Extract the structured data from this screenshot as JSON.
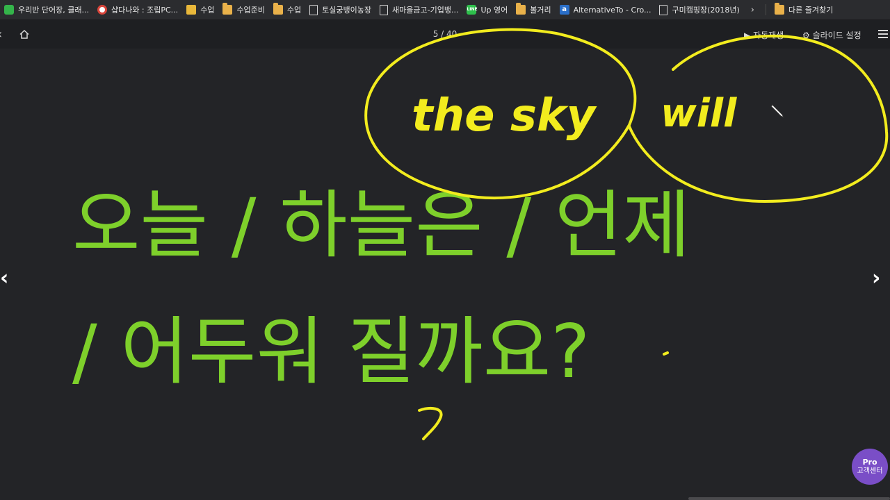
{
  "bookmarks": [
    {
      "label": "우리반 단어장, 클래...",
      "icon": "green"
    },
    {
      "label": "샵다나와 : 조립PC...",
      "icon": "red"
    },
    {
      "label": "수업",
      "icon": "img"
    },
    {
      "label": "수업준비",
      "icon": "folder"
    },
    {
      "label": "수업",
      "icon": "folder"
    },
    {
      "label": "토실궁뱅이농장",
      "icon": "page"
    },
    {
      "label": "새마을금고-기업뱅...",
      "icon": "page"
    },
    {
      "label": "Up 영어",
      "icon": "line"
    },
    {
      "label": "볼거리",
      "icon": "folder"
    },
    {
      "label": "AlternativeTo - Cro...",
      "icon": "at"
    },
    {
      "label": "구미캠핑장(2018년)",
      "icon": "page"
    }
  ],
  "bookmarks_overflow": "›",
  "other_bookmarks": "다른 즐겨찾기",
  "toolbar": {
    "page_indicator": "5 / 40",
    "autoplay_label": "▶ 자동재생",
    "slide_settings_label": "⚙ 슬라이드 설정"
  },
  "slide": {
    "line1": "오늘 / 하늘은 / 언제",
    "line2": "/ 어두워 질까요?",
    "handwriting": [
      "the sky",
      "will"
    ],
    "text_color": "#7ed02b",
    "ink_color": "#f2ec1e"
  },
  "nav": {
    "prev": "‹",
    "next": "›"
  },
  "support": {
    "badge": "Pro",
    "label": "고객센터"
  }
}
